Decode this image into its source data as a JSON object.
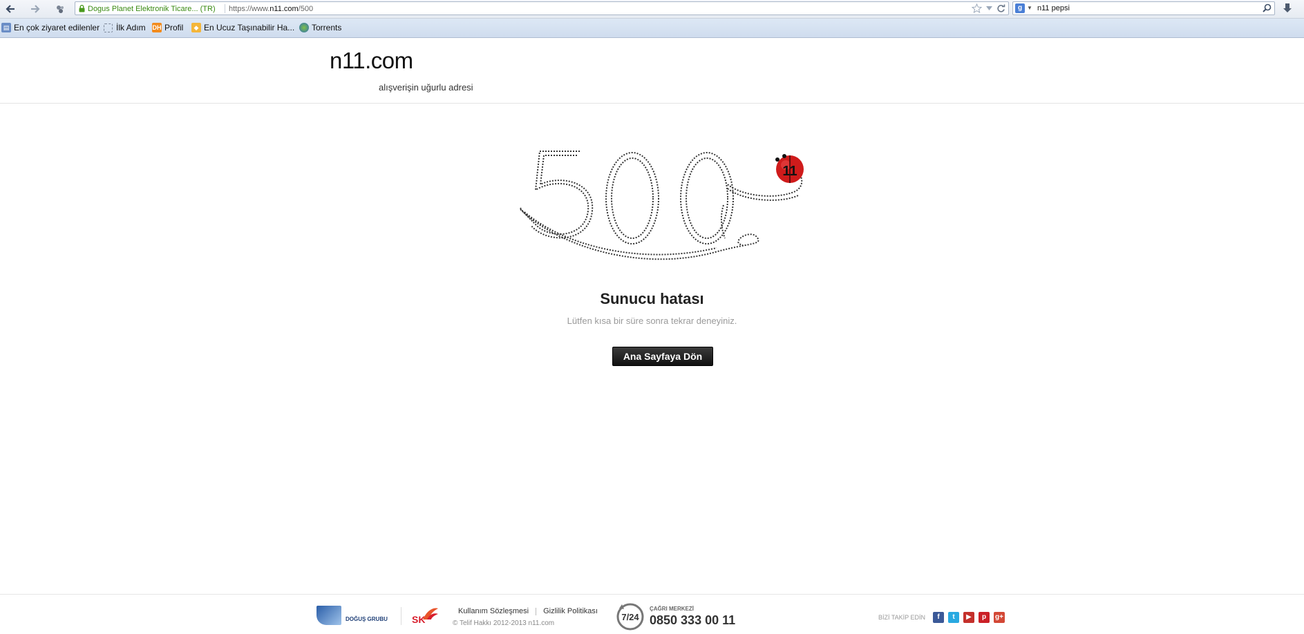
{
  "browser": {
    "ssl_identity": "Dogus Planet Elektronik Ticare... (TR)",
    "url_prefix": "https://www.",
    "url_domain": "n11.com",
    "url_path": "/500",
    "search_value": "n11 pepsi",
    "search_engine_icon": "google-icon"
  },
  "bookmarks": [
    {
      "label": "En çok ziyaret edilenler",
      "icon": "most-visited-icon"
    },
    {
      "label": "İlk Adım",
      "icon": "first-step-icon"
    },
    {
      "label": "Profil",
      "icon": "dh-icon"
    },
    {
      "label": "En Ucuz Taşınabilir Ha...",
      "icon": "cheap-portable-icon"
    },
    {
      "label": "Torrents",
      "icon": "torrents-icon"
    }
  ],
  "site": {
    "logo_text": "n11.com",
    "logo_tagline": "alışverişin uğurlu adresi",
    "error_code": "500",
    "error_title": "Sunucu hatası",
    "error_message": "Lütfen kısa bir süre sonra tekrar deneyiniz.",
    "home_button": "Ana Sayfaya Dön"
  },
  "footer": {
    "dogus_label": "DOĞUŞ GRUBU",
    "sk_label": "SK",
    "link_terms": "Kullanım Sözleşmesi",
    "link_privacy": "Gizlilik Politikası",
    "copyright": "© Telif Hakkı 2012-2013 n11.com",
    "callcenter_hours": "7/24",
    "callcenter_label": "ÇAĞRI MERKEZİ",
    "callcenter_phone": "0850 333 00 11",
    "follow_label": "BİZİ TAKİP EDİN",
    "social": [
      {
        "name": "facebook",
        "glyph": "f",
        "color": "#3b5998"
      },
      {
        "name": "twitter",
        "glyph": "t",
        "color": "#29a9e1"
      },
      {
        "name": "youtube",
        "glyph": "▶",
        "color": "#c4302b"
      },
      {
        "name": "pinterest",
        "glyph": "p",
        "color": "#cb2027"
      },
      {
        "name": "google-plus",
        "glyph": "g+",
        "color": "#d34836"
      }
    ]
  },
  "colors": {
    "brand_red": "#d0191b",
    "button_dark": "#1a1a1a",
    "ssl_green": "#3a8a12"
  }
}
